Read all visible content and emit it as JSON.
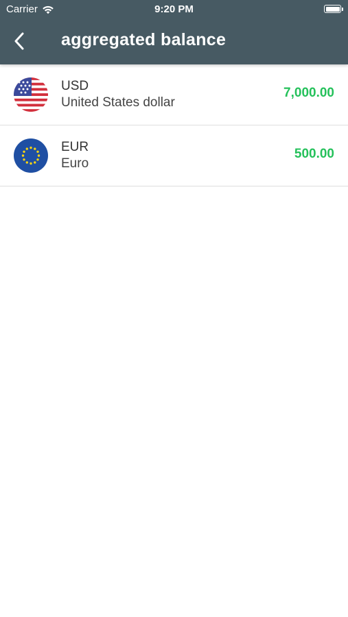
{
  "status_bar": {
    "carrier": "Carrier",
    "time": "9:20 PM"
  },
  "header": {
    "title": "aggregated balance",
    "back_icon": "chevron-left-icon"
  },
  "balances": [
    {
      "code": "USD",
      "name": "United States dollar",
      "amount": "7,000.00",
      "flag_icon": "us-flag-icon"
    },
    {
      "code": "EUR",
      "name": "Euro",
      "amount": "500.00",
      "flag_icon": "eu-flag-icon"
    }
  ],
  "colors": {
    "header_bg": "#475a63",
    "amount_green": "#25c15b",
    "divider": "#dedede"
  }
}
